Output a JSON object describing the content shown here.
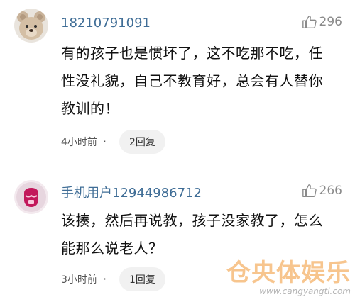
{
  "comments": [
    {
      "username": "18210791091",
      "likes": "296",
      "text": "有的孩子也是惯坏了，这不吃那不吃，任\n性没礼貌，自己不教育好，总会有人替你\n教训的！",
      "time": "4小时前",
      "dot": "·",
      "reply": "2回复",
      "avatar_icon": "teddy-bear-avatar"
    },
    {
      "username": "手机用户12944986712",
      "likes": "266",
      "text": "该揍，然后再说教，孩子没家教了，怎么\n能那么说老人？",
      "time": "3小时前",
      "dot": "·",
      "reply": "1回复",
      "avatar_icon": "default-user-avatar"
    }
  ],
  "watermark": {
    "main": "仓央体娱乐",
    "url": "www.cangyangti.com"
  },
  "colors": {
    "username": "#3f6d96",
    "watermark": "#f09632",
    "reply_bg": "#f1f1f1"
  }
}
